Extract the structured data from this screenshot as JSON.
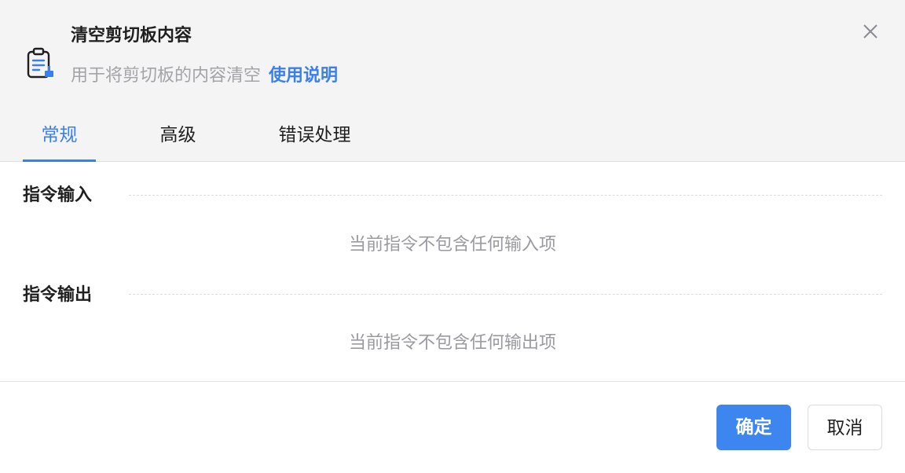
{
  "dialog": {
    "title": "清空剪切板内容",
    "subtitle": "用于将剪切板的内容清空",
    "help_link": "使用说明",
    "icon": "clipboard-clear-icon",
    "close_icon": "close-icon"
  },
  "tabs": [
    {
      "label": "常规",
      "active": true
    },
    {
      "label": "高级",
      "active": false
    },
    {
      "label": "错误处理",
      "active": false
    }
  ],
  "sections": {
    "input": {
      "title": "指令输入",
      "empty_text": "当前指令不包含任何输入项"
    },
    "output": {
      "title": "指令输出",
      "empty_text": "当前指令不包含任何输出项"
    }
  },
  "footer": {
    "confirm_label": "确定",
    "cancel_label": "取消"
  },
  "colors": {
    "accent": "#3b7fe8",
    "header_bg": "#f4f4f5",
    "primary_button": "#3d86f0"
  }
}
